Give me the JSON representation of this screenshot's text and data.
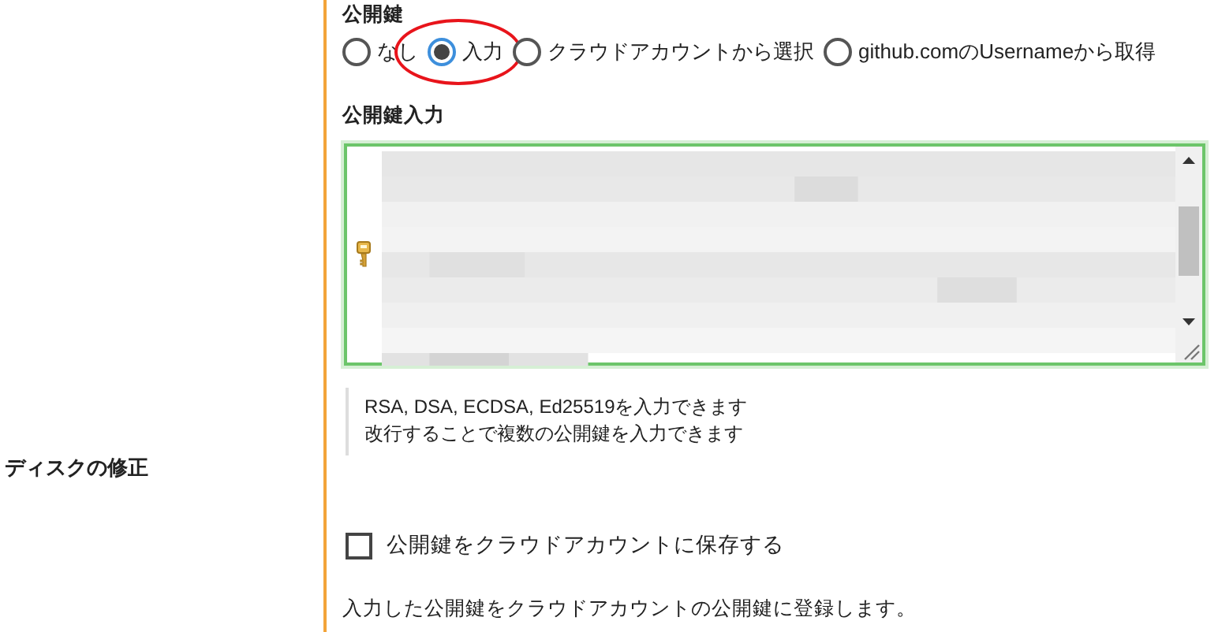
{
  "sidebar": {
    "label": "ディスクの修正"
  },
  "public_key": {
    "title": "公開鍵",
    "options": [
      {
        "label": "なし",
        "selected": false,
        "highlighted": false
      },
      {
        "label": "入力",
        "selected": true,
        "highlighted": true
      },
      {
        "label": "クラウドアカウントから選択",
        "selected": false,
        "highlighted": false
      },
      {
        "label": "github.comのUsernameから取得",
        "selected": false,
        "highlighted": false
      }
    ],
    "input": {
      "title": "公開鍵入力"
    },
    "help": [
      "RSA, DSA, ECDSA, Ed25519を入力できます",
      "改行することで複数の公開鍵を入力できます"
    ],
    "save_checkbox": {
      "label": "公開鍵をクラウドアカウントに保存する",
      "checked": false
    },
    "note": "入力した公開鍵をクラウドアカウントの公開鍵に登録します。"
  }
}
